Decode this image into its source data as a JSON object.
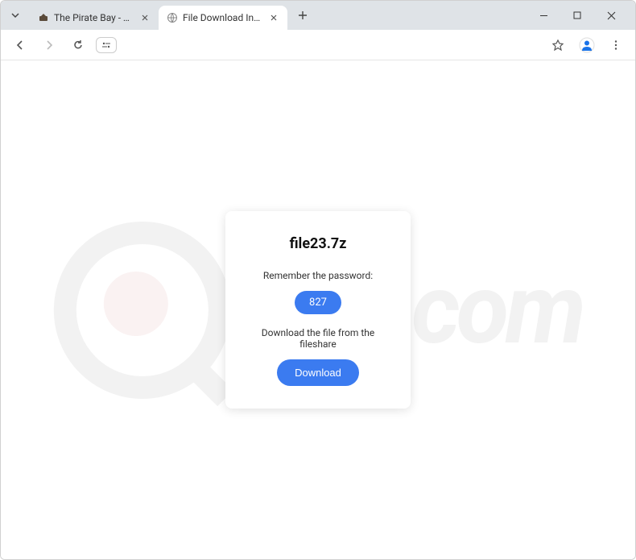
{
  "tabs": {
    "inactive": {
      "title": "The Pirate Bay - The galaxy's m..."
    },
    "active": {
      "title": "File Download Instructions for f..."
    }
  },
  "card": {
    "title": "file23.7z",
    "password_label": "Remember the password:",
    "password_value": "827",
    "download_text": "Download the file from the fileshare",
    "download_button": "Download"
  },
  "watermark": {
    "text": "risk.com"
  }
}
